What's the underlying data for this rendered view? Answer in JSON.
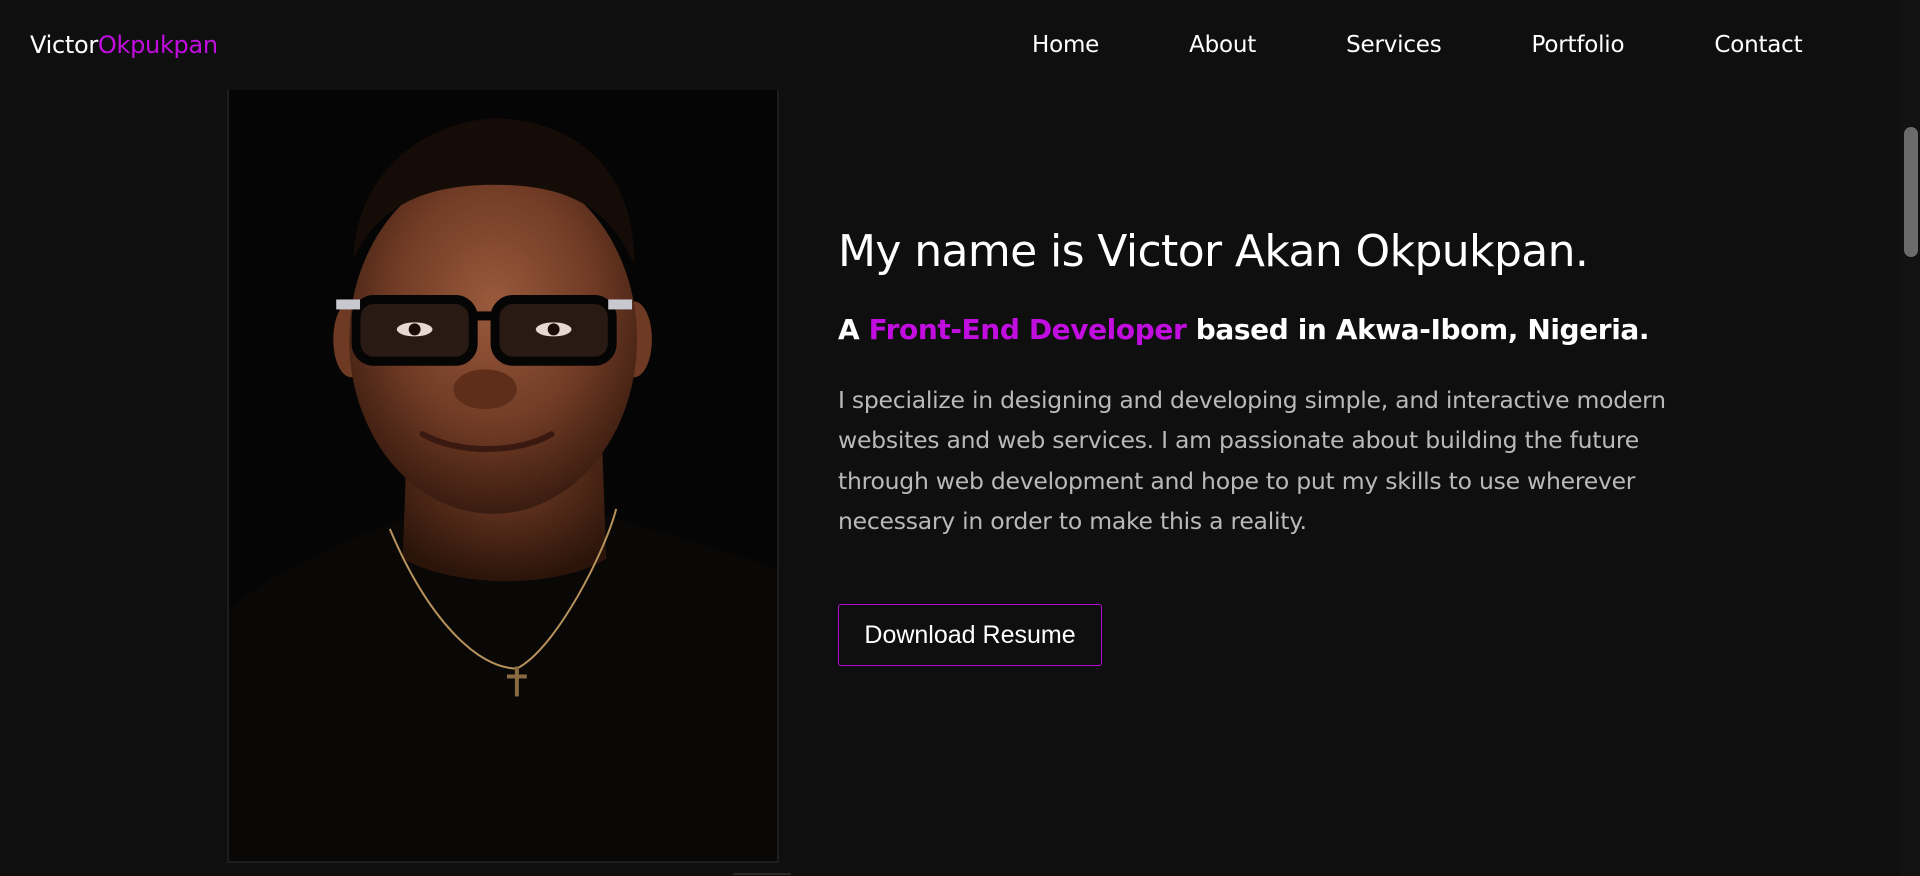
{
  "header": {
    "logo_first": "Victor",
    "logo_last": "Okpukpan",
    "nav": [
      "Home",
      "About",
      "Services",
      "Portfolio",
      "Contact"
    ]
  },
  "hero": {
    "title": "My name is Victor Akan Okpukpan.",
    "subtitle_prefix": "A",
    "subtitle_accent": "Front-End Developer",
    "subtitle_suffix": "based in Akwa-Ibom, Nigeria.",
    "description": "I specialize in designing and developing simple, and interactive modern websites and web services. I am passionate about building the future through web development and hope to put my skills to use wherever necessary in order to make this a reality.",
    "button_label": "Download Resume"
  },
  "colors": {
    "background": "#0f0f0f",
    "accent": "#c20de0",
    "text": "#ffffff",
    "muted_text": "#b9b9b9"
  },
  "portrait": {
    "icon": "person-portrait-photo"
  }
}
